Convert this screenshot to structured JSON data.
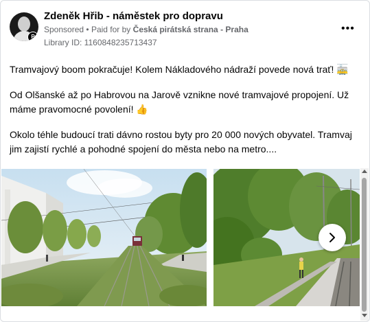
{
  "post": {
    "author": "Zdeněk Hřib - náměstek pro dopravu",
    "sponsored": "Sponsored",
    "separator": "•",
    "paid_for_prefix": "Paid for by",
    "payer": "Česká pirátská strana - Praha",
    "library_id": "Library ID: 1160848235713437",
    "paragraphs": [
      "Tramvajový boom pokračuje! Kolem Nákladového nádraží povede nová trať! 🚋",
      "Od Olšanské až po Habrovou na Jarově vznikne nové tramvajové propojení. Už máme pravomocné povolení! 👍",
      "Okolo téhle budoucí trati dávno rostou byty pro 20 000 nových obyvatel. Tramvaj jim zajistí rychlé a pohodné spojení do města nebo na metro...."
    ]
  },
  "colors": {
    "text": "#050505",
    "secondary": "#65676b",
    "border": "#dadde1"
  },
  "icons": {
    "more": "more-options-icon",
    "next": "chevron-right-icon"
  }
}
